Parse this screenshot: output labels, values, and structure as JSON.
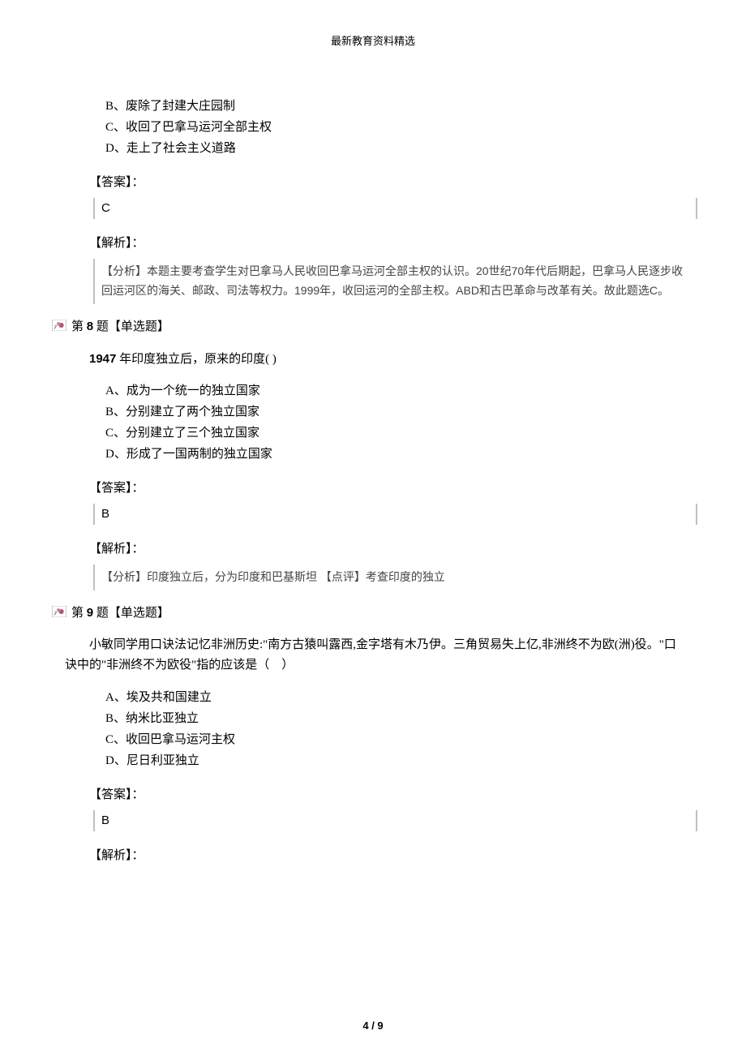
{
  "header": "最新教育资料精选",
  "footer": {
    "current": "4",
    "sep": " / ",
    "total": "9"
  },
  "q7_tail": {
    "options": {
      "B": "B、废除了封建大庄园制",
      "C": "C、收回了巴拿马运河全部主权",
      "D": "D、走上了社会主义道路"
    },
    "answer_label": "【答案】：",
    "answer_value": "C",
    "analysis_label": "【解析】：",
    "analysis_text": "【分析】本题主要考查学生对巴拿马人民收回巴拿马运河全部主权的认识。20世纪70年代后期起，巴拿马人民逐步收回运河区的海关、邮政、司法等权力。1999年，收回运河的全部主权。ABD和古巴革命与改革有关。故此题选C。"
  },
  "q8": {
    "header_pre": "第 ",
    "header_num": "8",
    "header_post": " 题【单选题】",
    "stem_year": "1947",
    "stem_rest": " 年印度独立后，原来的印度(       )",
    "options": {
      "A": "A、成为一个统一的独立国家",
      "B": "B、分别建立了两个独立国家",
      "C": "C、分别建立了三个独立国家",
      "D": "D、形成了一国两制的独立国家"
    },
    "answer_label": "【答案】：",
    "answer_value": "B",
    "analysis_label": "【解析】：",
    "analysis_text": "【分析】印度独立后，分为印度和巴基斯坦 【点评】考查印度的独立"
  },
  "q9": {
    "header_pre": "第 ",
    "header_num": "9",
    "header_post": " 题【单选题】",
    "stem": "　　小敏同学用口诀法记忆非洲历史:\"南方古猿叫露西,金字塔有木乃伊。三角贸易失上亿,非洲终不为欧(洲)役。\"口诀中的\"非洲终不为欧役\"指的应该是（　）",
    "options": {
      "A": "A、埃及共和国建立",
      "B": "B、纳米比亚独立",
      "C": "C、收回巴拿马运河主权",
      "D": "D、尼日利亚独立"
    },
    "answer_label": "【答案】：",
    "answer_value": "B",
    "analysis_label": "【解析】："
  }
}
